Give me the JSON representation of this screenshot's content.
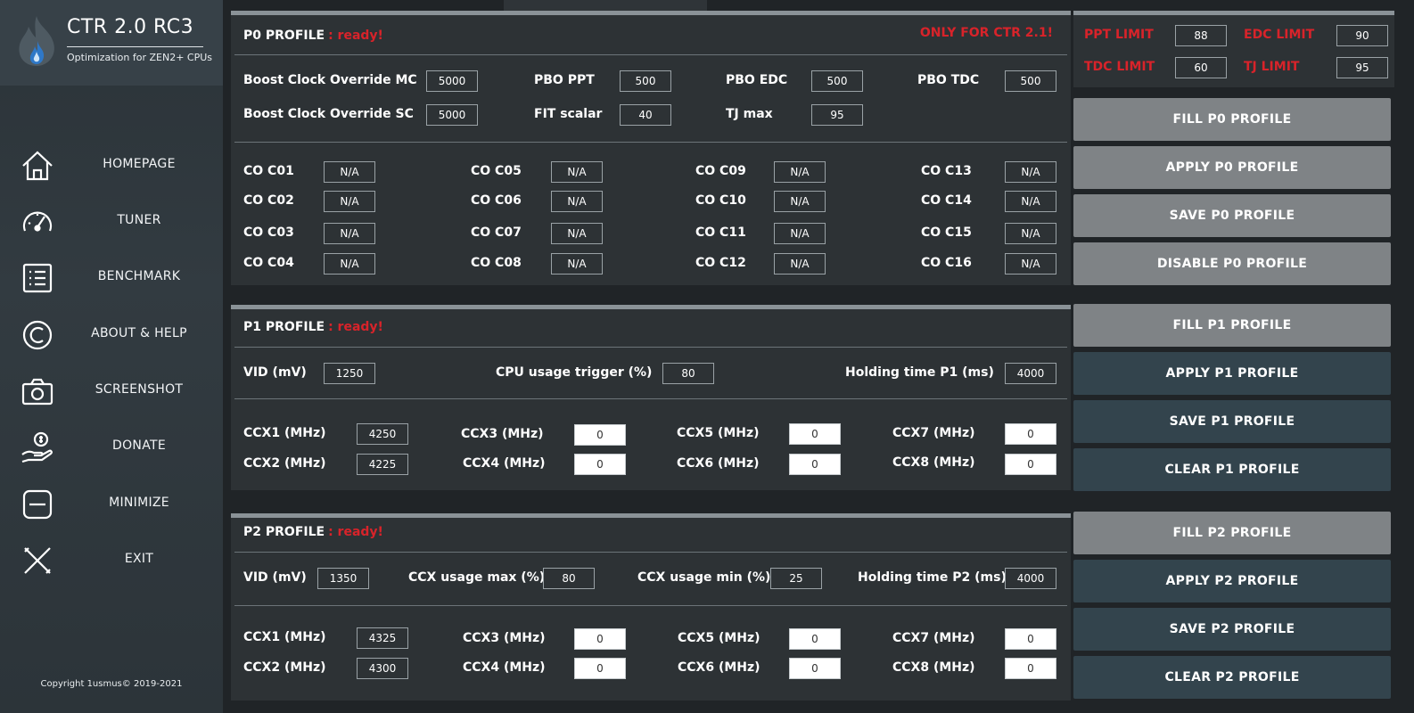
{
  "app": {
    "title": "CTR 2.0 RC3",
    "subtitle": "Optimization for ZEN2+ CPUs",
    "copyright": "Copyright 1usmus© 2019-2021"
  },
  "nav": [
    {
      "label": "HOMEPAGE",
      "icon": "home-icon"
    },
    {
      "label": "TUNER",
      "icon": "speedometer-icon"
    },
    {
      "label": "BENCHMARK",
      "icon": "list-icon"
    },
    {
      "label": "ABOUT & HELP",
      "icon": "copyright-icon"
    },
    {
      "label": "SCREENSHOT",
      "icon": "camera-icon"
    },
    {
      "label": "DONATE",
      "icon": "donate-hand-icon"
    },
    {
      "label": "MINIMIZE",
      "icon": "minimize-icon"
    },
    {
      "label": "EXIT",
      "icon": "close-icon"
    }
  ],
  "p0": {
    "title": "P0 PROFILE",
    "status": ": ready!",
    "warning": "ONLY FOR CTR 2.1!",
    "fields": {
      "boost_mc_label": "Boost Clock Override MC",
      "boost_mc": "5000",
      "boost_sc_label": "Boost Clock Override SC",
      "boost_sc": "5000",
      "ppt_label": "PBO PPT",
      "ppt": "500",
      "fit_label": "FIT scalar",
      "fit": "40",
      "edc_label": "PBO EDC",
      "edc": "500",
      "tjmax_label": "TJ max",
      "tjmax": "95",
      "tdc_label": "PBO TDC",
      "tdc": "500"
    },
    "co": [
      {
        "label": "CO C01",
        "value": "N/A"
      },
      {
        "label": "CO C02",
        "value": "N/A"
      },
      {
        "label": "CO C03",
        "value": "N/A"
      },
      {
        "label": "CO C04",
        "value": "N/A"
      },
      {
        "label": "CO C05",
        "value": "N/A"
      },
      {
        "label": "CO C06",
        "value": "N/A"
      },
      {
        "label": "CO C07",
        "value": "N/A"
      },
      {
        "label": "CO C08",
        "value": "N/A"
      },
      {
        "label": "CO C09",
        "value": "N/A"
      },
      {
        "label": "CO C10",
        "value": "N/A"
      },
      {
        "label": "CO C11",
        "value": "N/A"
      },
      {
        "label": "CO C12",
        "value": "N/A"
      },
      {
        "label": "CO C13",
        "value": "N/A"
      },
      {
        "label": "CO C14",
        "value": "N/A"
      },
      {
        "label": "CO C15",
        "value": "N/A"
      },
      {
        "label": "CO C16",
        "value": "N/A"
      }
    ]
  },
  "p1": {
    "title": "P1 PROFILE",
    "status": ": ready!",
    "vid_label": "VID (mV)",
    "vid": "1250",
    "trigger_label": "CPU usage trigger (%)",
    "trigger": "80",
    "hold_label": "Holding time P1 (ms)",
    "hold": "4000",
    "ccx": [
      {
        "label": "CCX1 (MHz)",
        "value": "4250"
      },
      {
        "label": "CCX2 (MHz)",
        "value": "4225"
      },
      {
        "label": "CCX3 (MHz)",
        "value": "0"
      },
      {
        "label": "CCX4 (MHz)",
        "value": "0"
      },
      {
        "label": "CCX5 (MHz)",
        "value": "0"
      },
      {
        "label": "CCX6 (MHz)",
        "value": "0"
      },
      {
        "label": "CCX7 (MHz)",
        "value": "0"
      },
      {
        "label": "CCX8 (MHz)",
        "value": "0"
      }
    ]
  },
  "p2": {
    "title": "P2 PROFILE",
    "status": ": ready!",
    "vid_label": "VID (mV)",
    "vid": "1350",
    "max_label": "CCX usage max (%)",
    "max": "80",
    "min_label": "CCX usage min (%)",
    "min": "25",
    "hold_label": "Holding time P2 (ms)",
    "hold": "4000",
    "ccx": [
      {
        "label": "CCX1 (MHz)",
        "value": "4325"
      },
      {
        "label": "CCX2 (MHz)",
        "value": "4300"
      },
      {
        "label": "CCX3 (MHz)",
        "value": "0"
      },
      {
        "label": "CCX4 (MHz)",
        "value": "0"
      },
      {
        "label": "CCX5 (MHz)",
        "value": "0"
      },
      {
        "label": "CCX6 (MHz)",
        "value": "0"
      },
      {
        "label": "CCX7 (MHz)",
        "value": "0"
      },
      {
        "label": "CCX8 (MHz)",
        "value": "0"
      }
    ]
  },
  "limits": {
    "ppt_label": "PPT LIMIT",
    "ppt": "88",
    "edc_label": "EDC LIMIT",
    "edc": "90",
    "tdc_label": "TDC LIMIT",
    "tdc": "60",
    "tj_label": "TJ LIMIT",
    "tj": "95"
  },
  "buttons": {
    "fill_p0": "FILL P0 PROFILE",
    "apply_p0": "APPLY P0 PROFILE",
    "save_p0": "SAVE P0 PROFILE",
    "disable_p0": "DISABLE P0 PROFILE",
    "fill_p1": "FILL P1 PROFILE",
    "apply_p1": "APPLY P1 PROFILE",
    "save_p1": "SAVE P1 PROFILE",
    "clear_p1": "CLEAR P1 PROFILE",
    "fill_p2": "FILL P2 PROFILE",
    "apply_p2": "APPLY P2 PROFILE",
    "save_p2": "SAVE P2 PROFILE",
    "clear_p2": "CLEAR P2 PROFILE"
  },
  "colors": {
    "accent_red": "#d8232a",
    "sidebar": "#323b41",
    "panel": "#2d3235",
    "button_grey": "#7f8386",
    "button_dark": "#33444d"
  }
}
